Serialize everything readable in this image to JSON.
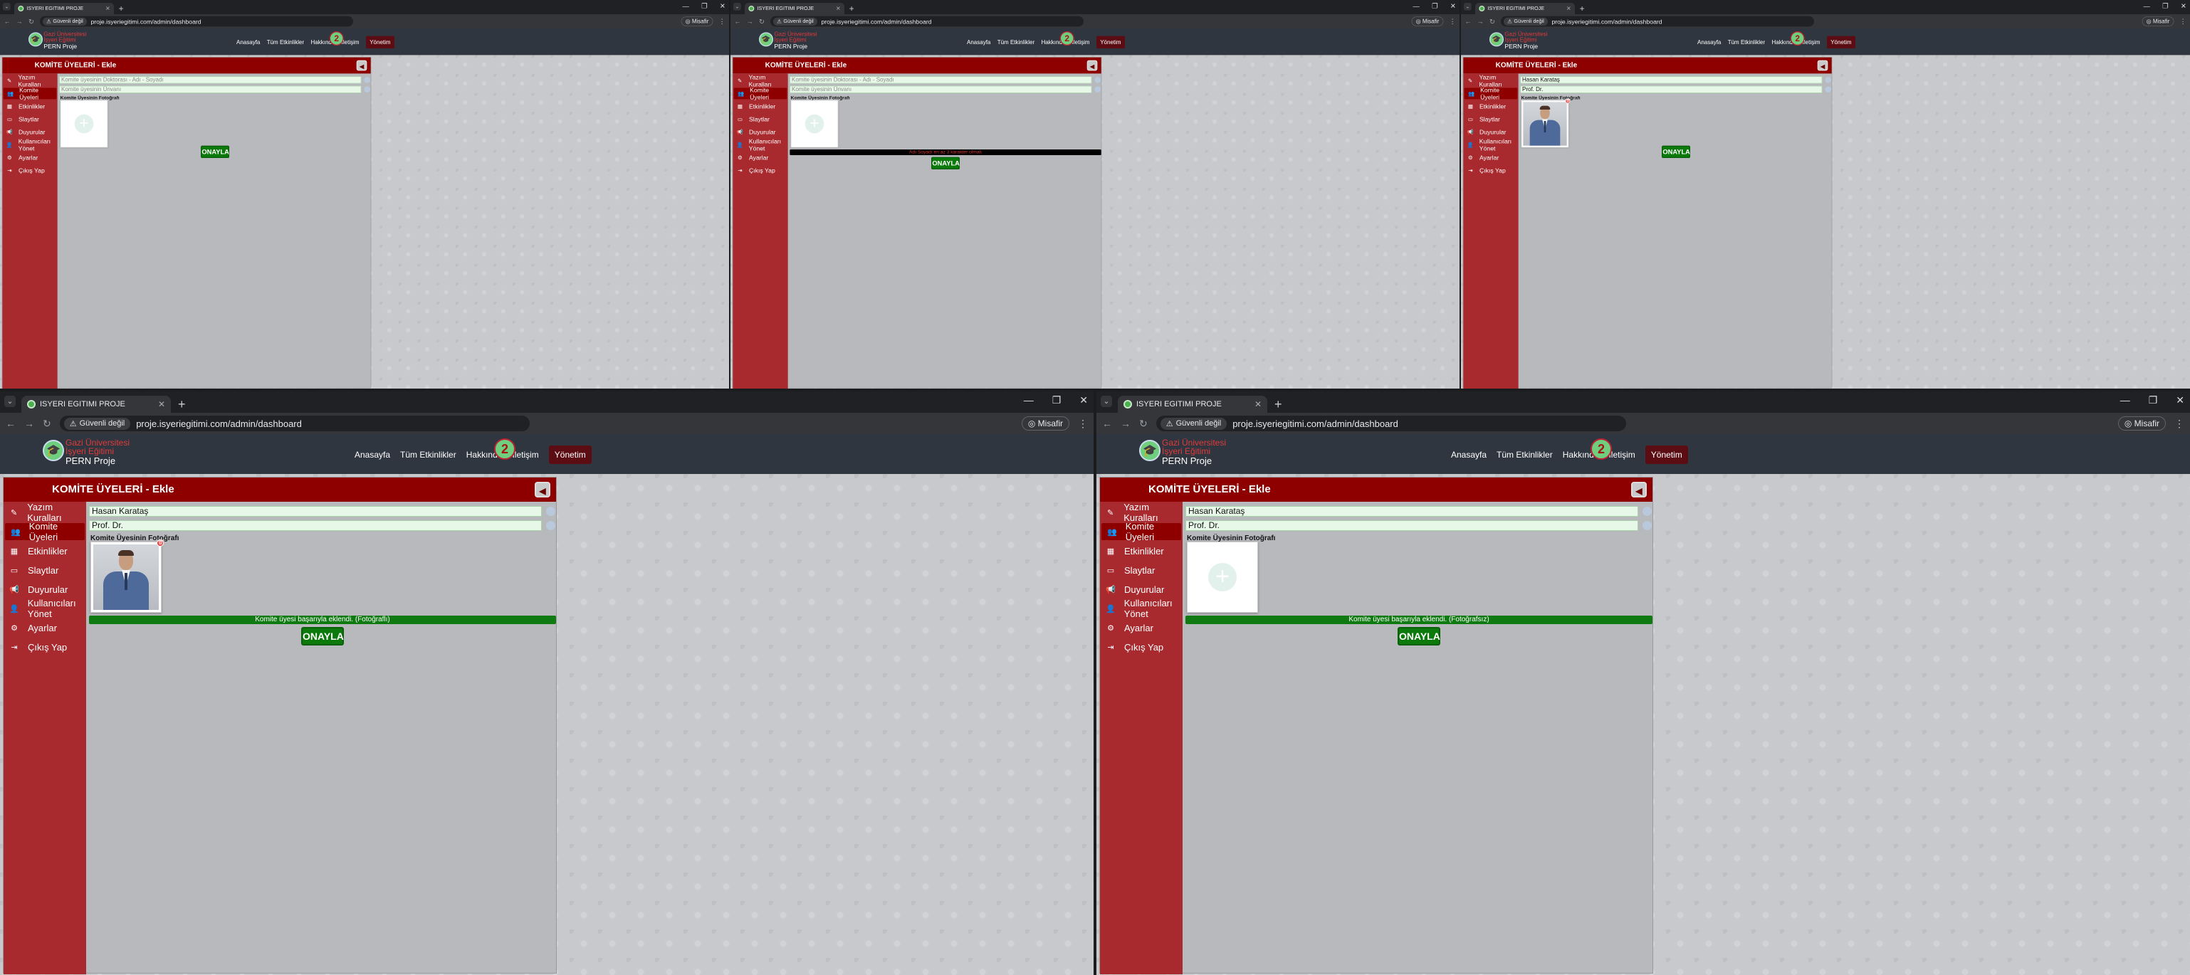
{
  "browser": {
    "tab_title": "ISYERI EGITIMI PROJE",
    "url": "proje.isyeriegitimi.com/admin/dashboard",
    "security_label": "Güvenli değil",
    "profile_label": "Misafir",
    "new_tab": "+",
    "window_controls": [
      "—",
      "❐",
      "✕"
    ]
  },
  "site": {
    "brand_line1": "Gazi Üniversitesi",
    "brand_line2": "İşyeri Eğitimi",
    "brand_line3": "PERN Proje",
    "nav": [
      "Anasayfa",
      "Tüm Etkinlikler",
      "Hakkında",
      "İletişim",
      "Yönetim"
    ],
    "nav_active": "Yönetim",
    "nav_logo": "2"
  },
  "panel": {
    "title": "KOMİTE ÜYELERİ - Ekle",
    "back_icon": "◀",
    "sidebar": [
      {
        "label": "Yazım Kuralları",
        "icon": "pen-icon",
        "glyph": "✎"
      },
      {
        "label": "Komite Üyeleri",
        "icon": "users-icon",
        "glyph": "👥"
      },
      {
        "label": "Etkinlikler",
        "icon": "calendar-icon",
        "glyph": "▦"
      },
      {
        "label": "Slaytlar",
        "icon": "monitor-icon",
        "glyph": "▭"
      },
      {
        "label": "Duyurular",
        "icon": "megaphone-icon",
        "glyph": "📢"
      },
      {
        "label": "Kullanıcıları Yönet",
        "icon": "user-cog-icon",
        "glyph": "👤"
      },
      {
        "label": "Ayarlar",
        "icon": "gear-icon",
        "glyph": "⚙"
      },
      {
        "label": "Çıkış Yap",
        "icon": "logout-icon",
        "glyph": "⇥"
      }
    ],
    "active_item": "Komite Üyeleri",
    "name_placeholder": "Komite üyesinin Doktorası - Adı - Soyadı",
    "title_placeholder": "Komite üyesinin Ünvanı",
    "photo_label": "Komite Üyesinin Fotoğrafı",
    "submit_label": "ONAYLA"
  },
  "states": [
    {
      "name_value": "",
      "title_value": "",
      "has_photo": false,
      "message": "",
      "message_type": ""
    },
    {
      "name_value": "",
      "title_value": "",
      "has_photo": false,
      "message": "Adı Soyadı en az 3 karakter olmalı",
      "message_type": "error"
    },
    {
      "name_value": "Hasan Karataş",
      "title_value": "Prof. Dr.",
      "has_photo": true,
      "message": "",
      "message_type": ""
    },
    {
      "name_value": "Hasan Karataş",
      "title_value": "Prof. Dr.",
      "has_photo": true,
      "message": "Komite üyesi başarıyla eklendi. (Fotoğraflı)",
      "message_type": "success"
    },
    {
      "name_value": "Hasan Karataş",
      "title_value": "Prof. Dr.",
      "has_photo": false,
      "message": "Komite üyesi başarıyla eklendi. (Fotoğrafsız)",
      "message_type": "success"
    }
  ],
  "colors": {
    "header_red": "#8e0000",
    "sidebar_red": "#a82a2f",
    "success_green": "#0f7a12",
    "button_green": "#0b7a0b",
    "error_text": "#d32f2f"
  }
}
